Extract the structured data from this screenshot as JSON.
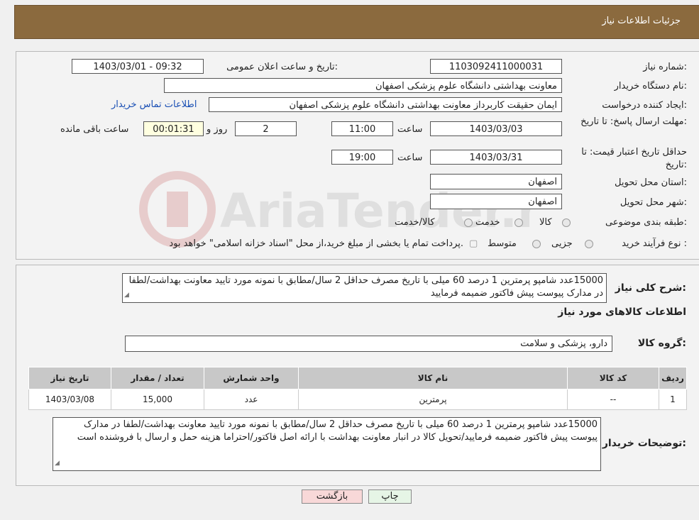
{
  "header": {
    "title": "جزئیات اطلاعات نیاز"
  },
  "watermark": {
    "text": "AriaTender.neT"
  },
  "form": {
    "need_number_label": "شماره نیاز:",
    "need_number": "1103092411000031",
    "announce_label": "تاریخ و ساعت اعلان عمومی:",
    "announce_value": "1403/03/01 - 09:32",
    "buyer_org_label": "نام دستگاه خریدار:",
    "buyer_org": "معاونت بهداشتی دانشگاه علوم پزشکی اصفهان",
    "creator_label": "ایجاد کننده درخواست:",
    "creator": "ایمان حقیقت کاربرداز معاونت بهداشتی دانشگاه علوم پزشکی اصفهان",
    "contact_link": "اطلاعات تماس خریدار",
    "deadline_label": "مهلت ارسال پاسخ: تا تاریخ:",
    "deadline_date": "1403/03/03",
    "time_label": "ساعت",
    "deadline_time": "11:00",
    "days_value": "2",
    "days_label": "روز و",
    "remaining_time": "00:01:31",
    "remaining_label": "ساعت باقی مانده",
    "validity_label": "حداقل تاریخ اعتبار قیمت: تا تاریخ:",
    "validity_date": "1403/03/31",
    "validity_time": "19:00",
    "province_label": "استان محل تحویل:",
    "province": "اصفهان",
    "city_label": "شهر محل تحویل:",
    "city": "اصفهان",
    "category_label": "طبقه بندی موضوعی:",
    "category_options": [
      "کالا",
      "خدمت",
      "کالا/خدمت"
    ],
    "purchase_type_label": "نوع فرآیند خرید :",
    "purchase_options": [
      "جزیی",
      "متوسط"
    ],
    "purchase_note": "پرداخت تمام یا بخشی از مبلغ خرید،از محل \"اسناد خزانه اسلامی\" خواهد بود."
  },
  "summary": {
    "label": "شرح کلی نیاز:",
    "text": "15000عدد شامپو پرمترین 1 درصد 60 میلی با تاریخ مصرف حداقل 2 سال/مطابق با نمونه مورد تایید معاونت بهداشت/لطفا در مدارک پیوست پیش فاکتور ضمیمه فرمایید",
    "items_title": "اطلاعات کالاهای مورد نیاز",
    "group_label": "گروه کالا:",
    "group_value": "دارو، پزشکی و سلامت"
  },
  "table": {
    "headers": [
      "ردیف",
      "کد کالا",
      "نام کالا",
      "واحد شمارش",
      "تعداد / مقدار",
      "تاریخ نیاز"
    ],
    "rows": [
      [
        "1",
        "--",
        "پرمترین",
        "عدد",
        "15,000",
        "1403/03/08"
      ]
    ]
  },
  "buyer_notes": {
    "label": "توضیحات خریدار:",
    "text": "15000عدد شامپو پرمترین 1 درصد 60 میلی با تاریخ مصرف حداقل 2 سال/مطابق با نمونه مورد تایید معاونت بهداشت/لطفا در مدارک پیوست پیش فاکتور ضمیمه فرمایید/تحویل کالا در انبار معاونت بهداشت با ارائه اصل فاکتور/احتراما هزینه حمل و ارسال با فروشنده است"
  },
  "buttons": {
    "print": "چاپ",
    "back": "بازگشت"
  },
  "colors": {
    "header": "#8b6a3e",
    "back_button": "#f8d8d8",
    "print_button": "#e6f5e6"
  }
}
